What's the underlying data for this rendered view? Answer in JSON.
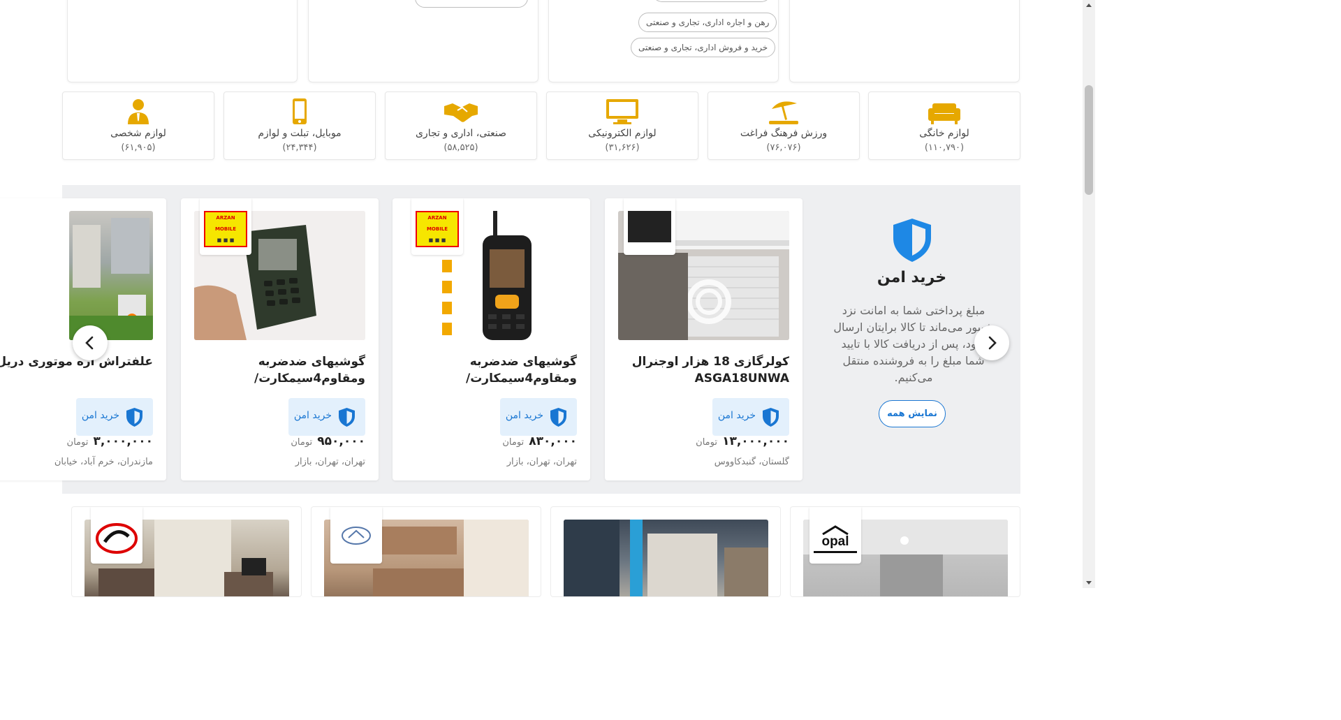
{
  "top_pills": [
    "رهن و اجاره اداری، تجاری و صنعتی",
    "خرید و فروش اداری، تجاری و صنعتی"
  ],
  "categories": [
    {
      "label": "لوازم شخصی",
      "count": "(۶۱,۹۰۵)",
      "icon": "person-icon"
    },
    {
      "label": "موبایل، تبلت و لوازم",
      "count": "(۲۴,۳۴۴)",
      "icon": "mobile-icon"
    },
    {
      "label": "صنعتی، اداری و تجاری",
      "count": "(۵۸,۵۲۵)",
      "icon": "handshake-icon"
    },
    {
      "label": "لوازم الکترونیکی",
      "count": "(۳۱,۶۲۶)",
      "icon": "monitor-icon"
    },
    {
      "label": "ورزش فرهنگ فراغت",
      "count": "(۷۶,۰۷۶)",
      "icon": "beach-umbrella-icon"
    },
    {
      "label": "لوازم خانگی",
      "count": "(۱۱۰,۷۹۰)",
      "icon": "sofa-icon"
    }
  ],
  "safe_section": {
    "title": "خرید امن",
    "description": "مبلغ پرداختی شما به امانت نزد شیپور می‌ماند تا کالا برایتان ارسال شود، پس از دریافت کالا با تایید شما مبلغ را به فروشنده منتقل می‌کنیم.",
    "show_all": "نمایش همه"
  },
  "products": [
    {
      "title": "کولرگازی 18 هزار اوجنرال ASGA18UNWA",
      "safe_label": "خرید امن",
      "price": "۱۳,۰۰۰,۰۰۰",
      "currency": "تومان",
      "location": "گلستان، گنبدکاووس"
    },
    {
      "title": "گوشیهای ضدضربه ومقاوم4سیمکارت/",
      "safe_label": "خرید امن",
      "price": "۸۳۰,۰۰۰",
      "currency": "تومان",
      "location": "تهران، تهران، بازار"
    },
    {
      "title": "گوشیهای ضدضربه ومقاوم4سیمکارت/",
      "safe_label": "خرید امن",
      "price": "۹۵۰,۰۰۰",
      "currency": "تومان",
      "location": "تهران، تهران، بازار"
    },
    {
      "title": "علفتراش اره موتوری دریل سمپاش کفکش",
      "safe_label": "خرید امن",
      "price": "۳,۰۰۰,۰۰۰",
      "currency": "تومان",
      "location": "مازندران، خرم آباد، خیابان"
    }
  ],
  "logo_texts": {
    "arzan": "ARZAN MOBILE",
    "opal": "opal"
  },
  "colors": {
    "category_icon": "#e6a800",
    "safe_blue": "#1976d2",
    "band_bg": "#eeeff1"
  }
}
